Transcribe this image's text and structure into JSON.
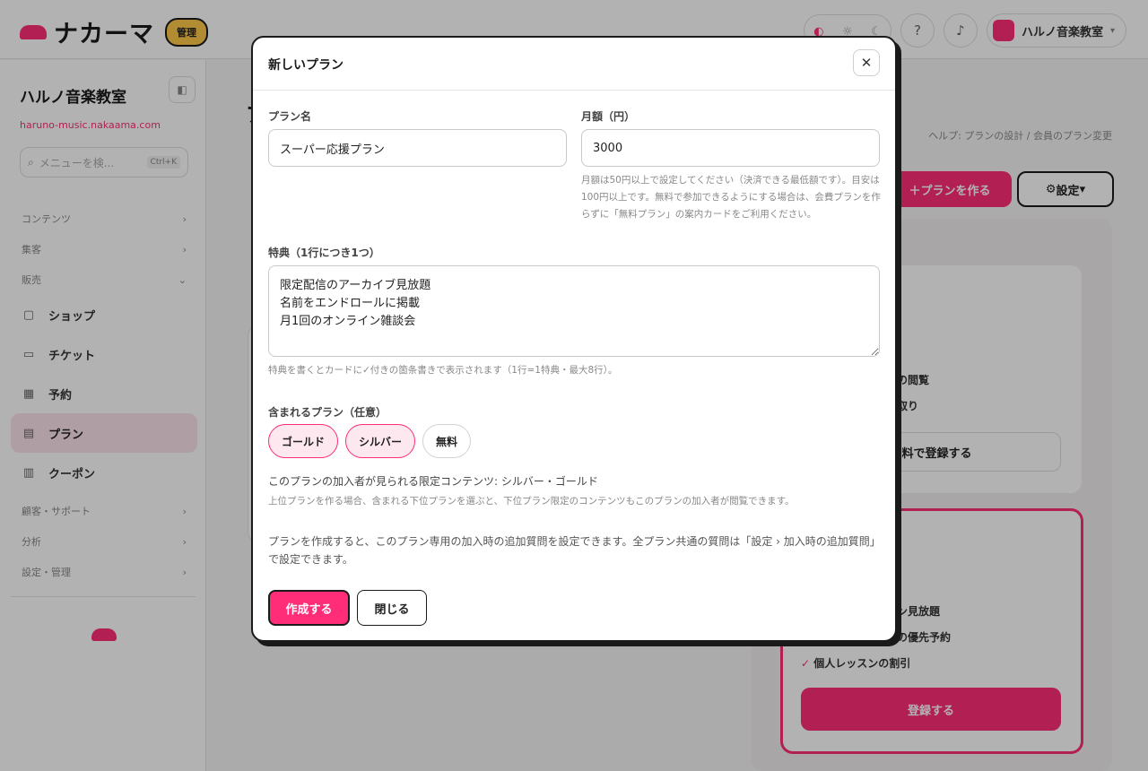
{
  "app": {
    "logo_text": "ナカーマ",
    "admin_badge": "管理",
    "theme_icons": [
      "half-circle-icon",
      "sun-icon",
      "moon-icon"
    ],
    "user_name": "ハルノ音楽教室"
  },
  "sidebar": {
    "title": "ハルノ音楽教室",
    "url": "haruno-music.nakaama.com",
    "search_placeholder": "メニューを検...",
    "search_shortcut": "Ctrl+K",
    "sections": [
      "コンテンツ",
      "集客",
      "販売"
    ],
    "items": [
      {
        "label": "ショップ",
        "icon": "bag-icon"
      },
      {
        "label": "チケット",
        "icon": "ticket-icon"
      },
      {
        "label": "予約",
        "icon": "calendar-icon"
      },
      {
        "label": "プラン",
        "icon": "card-icon",
        "active": true
      },
      {
        "label": "クーポン",
        "icon": "coupon-icon"
      }
    ],
    "lower_sections": [
      "顧客・サポート",
      "分析",
      "設定・管理"
    ]
  },
  "background": {
    "breadcrumb": "ヘルプ: プランの設計 / 会員のプラン変更",
    "create_button": "プランを作る",
    "settings_button": "設定",
    "card1_lines": [
      "の閲覧",
      "取り"
    ],
    "card1_button": "無料で登録する",
    "card2_lines": [
      "ン見放題",
      "の優先予約",
      "個人レッスンの割引"
    ],
    "card2_button": "登録する"
  },
  "modal": {
    "title": "新しいプラン",
    "plan_name_label": "プラン名",
    "plan_name_value": "スーパー応援プラン",
    "price_label": "月額（円）",
    "price_value": "3000",
    "price_help": "月額は50円以上で設定してください（決済できる最低額です）。目安は100円以上です。無料で参加できるようにする場合は、会費プランを作らずに「無料プラン」の案内カードをご利用ください。",
    "benefits_label": "特典（1行につき1つ）",
    "benefits_value": "限定配信のアーカイブ見放題\n名前をエンドロールに掲載\n月1回のオンライン雑談会",
    "benefits_help": "特典を書くとカードに✓付きの箇条書きで表示されます（1行=1特典・最大8行）。",
    "included_label": "含まれるプラン（任意）",
    "included_plans": [
      {
        "label": "ゴールド",
        "selected": true
      },
      {
        "label": "シルバー",
        "selected": true
      },
      {
        "label": "無料",
        "selected": false
      }
    ],
    "limited_content": "このプランの加入者が見られる限定コンテンツ: シルバー・ゴールド",
    "included_help": "上位プランを作る場合、含まれる下位プランを選ぶと、下位プラン限定のコンテンツもこのプランの加入者が閲覧できます。",
    "note": "プランを作成すると、このプラン専用の加入時の追加質問を設定できます。全プラン共通の質問は「設定 › 加入時の追加質問」で設定できます。",
    "create_button": "作成する",
    "close_button": "閉じる"
  },
  "colors": {
    "accent": "#ff2d78",
    "chip_selected_bg": "#fde8ef",
    "overlay": "rgba(0,0,0,0.30)"
  }
}
